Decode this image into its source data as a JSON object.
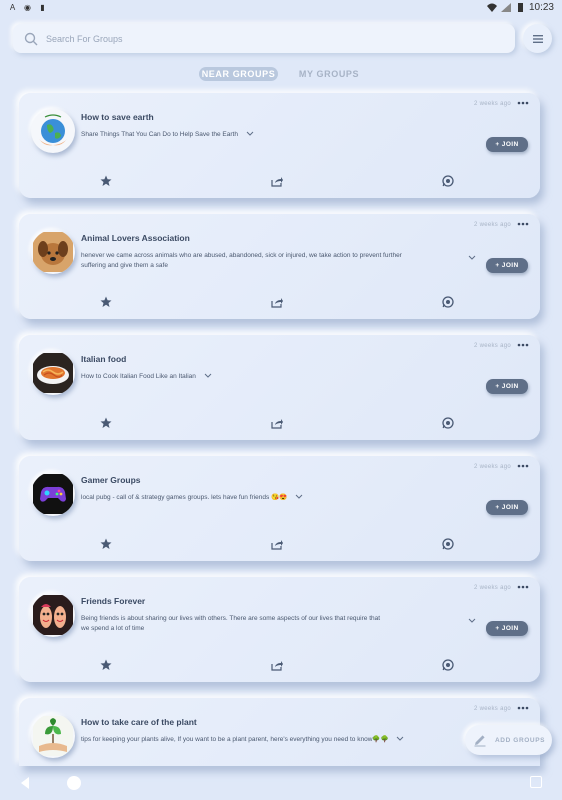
{
  "status_bar": {
    "left_icons": [
      "A",
      "◉",
      "▮"
    ],
    "time": "10:23"
  },
  "search": {
    "placeholder": "Search For Groups",
    "icon": "search-icon"
  },
  "menu": {
    "icon": "menu-icon"
  },
  "tabs": [
    {
      "label": "NEAR GROUPS",
      "active": true
    },
    {
      "label": "MY GROUPS",
      "active": false
    }
  ],
  "groups": [
    {
      "title": "How to save earth",
      "description": "Share Things That You Can Do to Help Save the Earth",
      "time": "2 weeks ago",
      "join_label": "+ JOIN",
      "avatar": "earth-image"
    },
    {
      "title": "Animal Lovers Association",
      "description": "henever we came across animals who are abused, abandoned, sick or injured, we take action to prevent further suffering and give them a safe",
      "time": "2 weeks ago",
      "join_label": "+ JOIN",
      "avatar": "dog-image"
    },
    {
      "title": "Italian food",
      "description": "How to Cook Italian Food Like an Italian",
      "time": "2 weeks ago",
      "join_label": "+ JOIN",
      "avatar": "pasta-image"
    },
    {
      "title": "Gamer Groups",
      "description": "local pubg - call of & strategy games groups. lets have fun friends 😘😍",
      "time": "2 weeks ago",
      "join_label": "+ JOIN",
      "avatar": "gamepad-image"
    },
    {
      "title": "Friends Forever",
      "description": "Being friends is about sharing our lives with others. There are some aspects of our lives that require that we spend a lot of time",
      "time": "2 weeks ago",
      "join_label": "+ JOIN",
      "avatar": "friends-image"
    },
    {
      "title": "How to take care of the plant",
      "description": "tips for keeping your plants alive, If you want to be a plant parent, here's everything you need to know🌳🌳",
      "time": "2 weeks ago",
      "join_label": "+ JOIN",
      "avatar": "plant-image"
    }
  ],
  "fab": {
    "label": "ADD GROUPS",
    "icon": "pencil-icon"
  },
  "colors": {
    "background": "#dfe8f8",
    "accent": "#5f6f88",
    "tab_active": "#b9c8de",
    "muted_text": "#a8b4c6"
  }
}
